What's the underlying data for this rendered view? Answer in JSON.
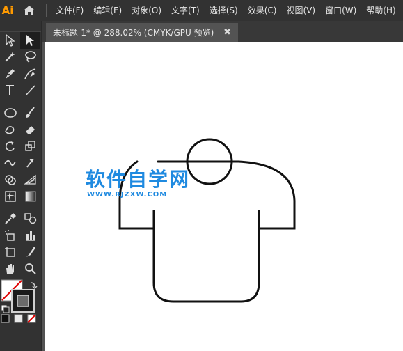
{
  "app": {
    "logo_text": "Ai",
    "logo_color": "#ff9a00"
  },
  "menu": {
    "items": [
      "文件(F)",
      "编辑(E)",
      "对象(O)",
      "文字(T)",
      "选择(S)",
      "效果(C)",
      "视图(V)",
      "窗口(W)",
      "帮助(H)"
    ]
  },
  "document": {
    "tab_title": "未标题-1* @ 288.02% (CMYK/GPU 预览)",
    "close_glyph": "✖"
  },
  "watermark": {
    "title": "软件自学网",
    "url": "WWW.RJZXW.COM",
    "color": "#1f8ae0"
  },
  "tools": {
    "icons": [
      [
        "selection-icon",
        "direct-selection-icon"
      ],
      [
        "magic-wand-icon",
        "lasso-icon"
      ],
      [
        "pen-icon",
        "curvature-icon"
      ],
      [
        "type-icon",
        "line-segment-icon"
      ],
      [
        "ellipse-icon",
        "paintbrush-icon"
      ],
      [
        "shaper-icon",
        "eraser-icon"
      ],
      [
        "rotate-icon",
        "scale-icon"
      ],
      [
        "width-icon",
        "puppet-warp-icon"
      ],
      [
        "shape-builder-icon",
        "perspective-grid-icon"
      ],
      [
        "mesh-icon",
        "gradient-icon"
      ],
      [
        "eyedropper-icon",
        "blend-icon"
      ],
      [
        "symbol-sprayer-icon",
        "column-graph-icon"
      ],
      [
        "artboard-icon",
        "slice-icon"
      ],
      [
        "hand-icon",
        "zoom-icon"
      ]
    ]
  }
}
